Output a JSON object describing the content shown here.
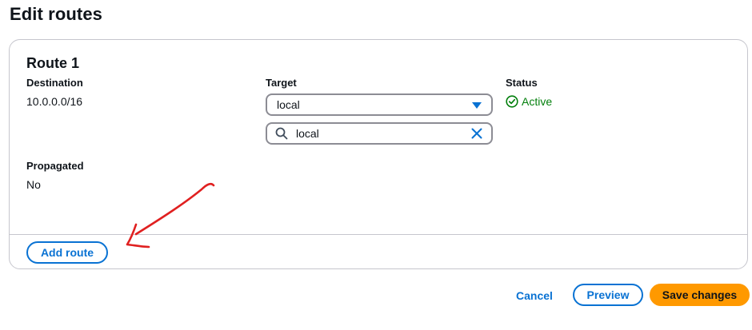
{
  "page": {
    "title": "Edit routes"
  },
  "route": {
    "title": "Route 1",
    "destination": {
      "label": "Destination",
      "value": "10.0.0.0/16"
    },
    "target": {
      "label": "Target",
      "selected": "local",
      "filter": "local"
    },
    "status": {
      "label": "Status",
      "value": "Active",
      "color": "#037f0c"
    },
    "propagated": {
      "label": "Propagated",
      "value": "No"
    }
  },
  "actions": {
    "add_route": "Add route",
    "cancel": "Cancel",
    "preview": "Preview",
    "save": "Save changes"
  },
  "colors": {
    "accent": "#0972d3",
    "primary_button": "#ff9900",
    "annotation": "#e02020"
  }
}
